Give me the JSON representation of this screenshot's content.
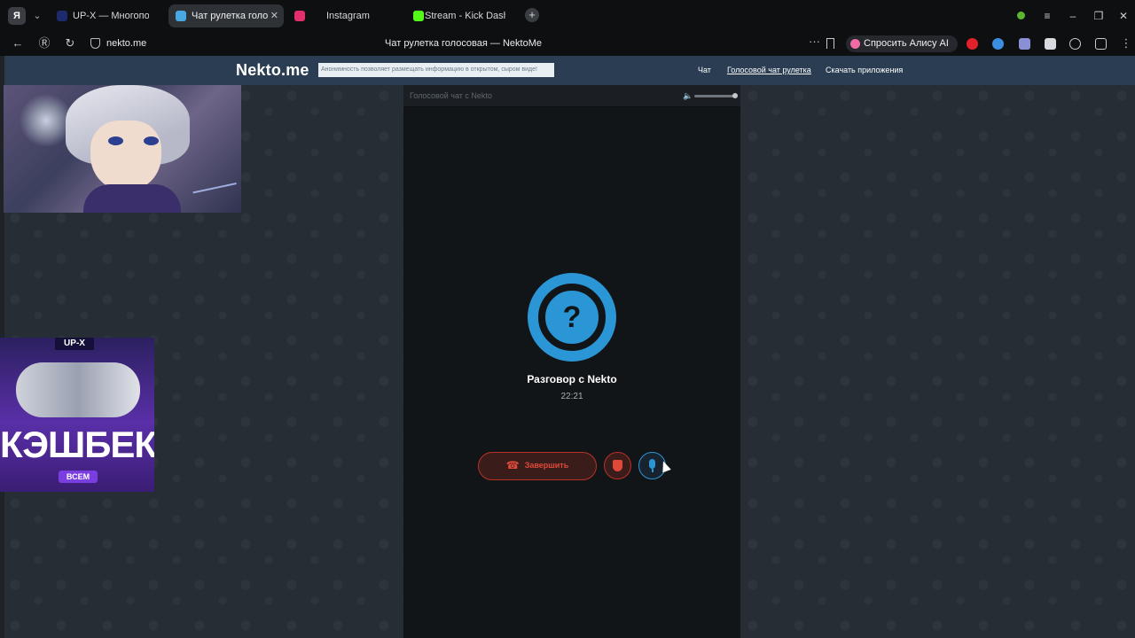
{
  "browser": {
    "tabs": [
      {
        "label": "UP-X — Многопользоват",
        "active": false,
        "favicon_color": "#1d2a6b"
      },
      {
        "label": "Чат рулетка голосова",
        "active": true,
        "favicon_color": "#4aa8e0"
      },
      {
        "label": "Instagram",
        "active": false,
        "favicon_color": "#e1306c"
      },
      {
        "label": "Stream - Kick Dashboard",
        "active": false,
        "favicon_color": "#53fc18"
      }
    ],
    "url": "nekto.me",
    "page_title": "Чат рулетка голосовая — NektoMe",
    "alice_button": "Спросить Алису AI"
  },
  "site": {
    "brand": "Nekto.me",
    "notice": "Анонимность позволяет размещать информацию в открытом, сыром виде!",
    "nav": {
      "chat": "Чат",
      "voice": "Голосовой чат рулетка",
      "apps": "Скачать приложения"
    }
  },
  "ads": {
    "brand": "UP-X",
    "headline": "КЭШБЕК",
    "sub": "ВСЕМ"
  },
  "voice_chat": {
    "header": "Голосовой чат с Nekto",
    "avatar_symbol": "?",
    "title": "Разговор с Nekto",
    "timer": "22:21",
    "end_label": "Завершить"
  },
  "colors": {
    "accent_blue": "#2a96d6",
    "danger_red": "#e0493a",
    "header_bg": "#2a3d52"
  }
}
